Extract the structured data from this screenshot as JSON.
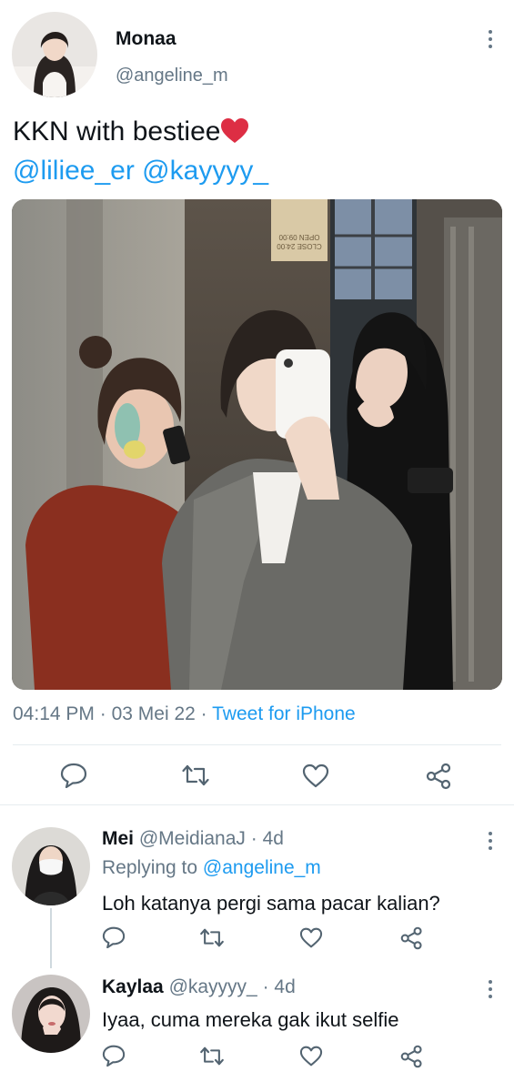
{
  "tweet": {
    "author_name": "Monaa",
    "author_handle": "@angeline_m",
    "text": "KKN with bestiee",
    "emoji": "❤️",
    "mentions": "@liliee_er @kayyyy_",
    "time": "04:14 PM",
    "date": "03 Mei 22",
    "separator": "·",
    "source": "Tweet for iPhone",
    "photo_sign_lines": [
      "OPEN 09:00",
      "CLOSE 24:00"
    ]
  },
  "replies": [
    {
      "name": "Mei",
      "handle": "@MeidianaJ",
      "age": "· 4d",
      "replying_prefix": "Replying to",
      "replying_to": "@angeline_m",
      "text": "Loh katanya pergi sama pacar kalian?"
    },
    {
      "name": "Kaylaa",
      "handle": "@kayyyy_",
      "age": "· 4d",
      "text": "Iyaa, cuma mereka gak ikut selfie"
    }
  ],
  "icons": {
    "reply": "comment-icon",
    "retweet": "retweet-icon",
    "like": "heart-icon",
    "share": "share-icon",
    "more": "more-vertical-icon"
  },
  "colors": {
    "link": "#1d9bf0",
    "muted": "#657786",
    "text": "#0f1419",
    "heart": "#e0245e",
    "divider": "#e6ecf0"
  }
}
